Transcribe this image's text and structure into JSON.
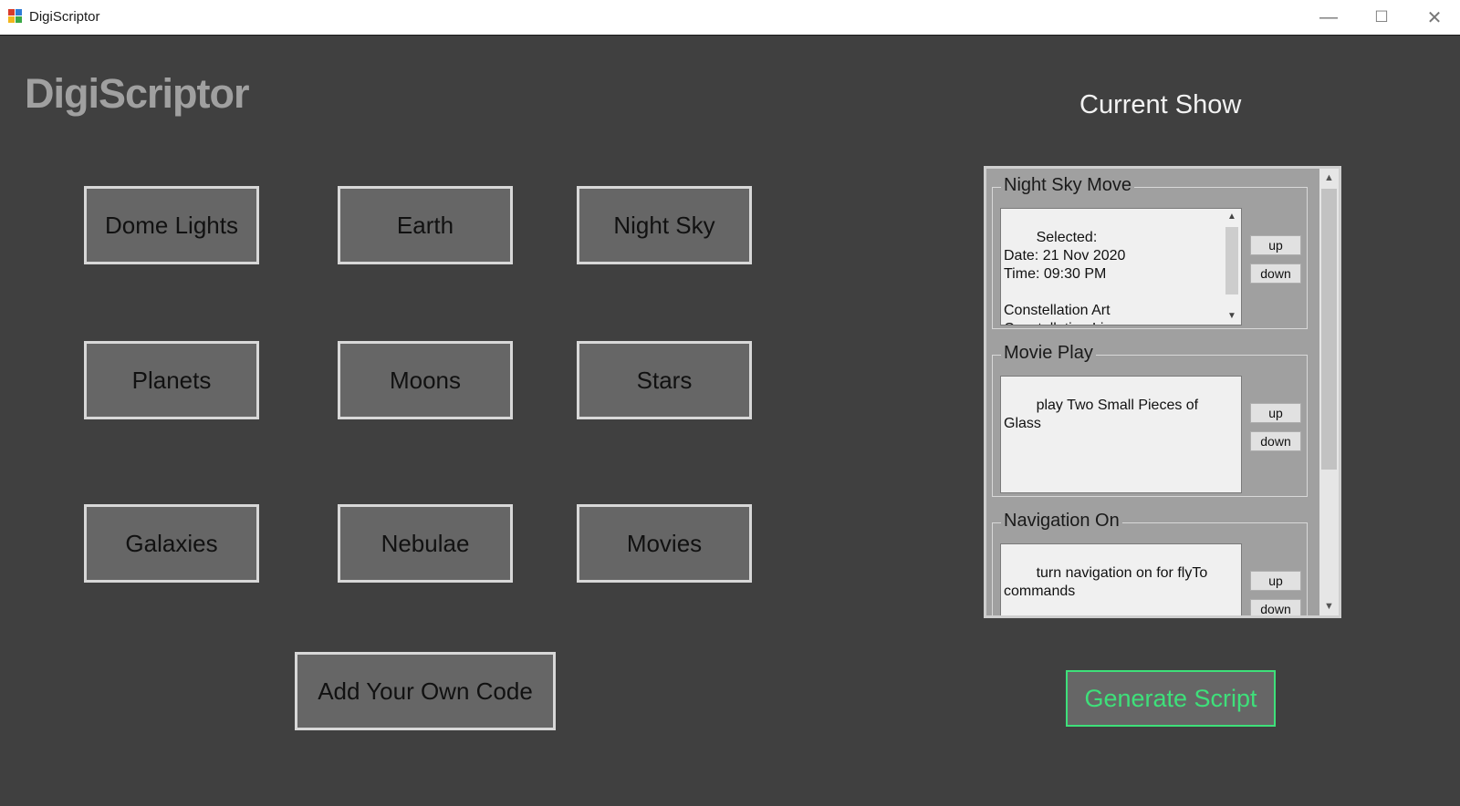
{
  "window": {
    "title": "DigiScriptor",
    "minimize": "—",
    "maximize": "☐",
    "close": "✕"
  },
  "app": {
    "logo": "DigiScriptor",
    "current_show_title": "Current Show",
    "generate_label": "Generate Script"
  },
  "categories": [
    {
      "label": "Dome Lights"
    },
    {
      "label": "Earth"
    },
    {
      "label": "Night Sky"
    },
    {
      "label": "Planets"
    },
    {
      "label": "Moons"
    },
    {
      "label": "Stars"
    },
    {
      "label": "Galaxies"
    },
    {
      "label": "Nebulae"
    },
    {
      "label": "Movies"
    },
    {
      "label": "Add Your Own Code"
    }
  ],
  "show_items": [
    {
      "title": "Night Sky Move",
      "text": "Selected:\nDate: 21 Nov 2020\nTime: 09:30 PM\n\nConstellation Art\nConstellation Lines",
      "up": "up",
      "down": "down"
    },
    {
      "title": "Movie Play",
      "text": "play Two Small Pieces of Glass",
      "up": "up",
      "down": "down"
    },
    {
      "title": "Navigation On",
      "text": "turn navigation on for flyTo commands",
      "up": "up",
      "down": "down"
    }
  ],
  "colors": {
    "background": "#404040",
    "button_face": "#666666",
    "panel": "#a0a0a0",
    "accent": "#3ee07a"
  },
  "icons": {
    "app_icon": "app-grid-icon",
    "scroll_up": "chevron-up-icon",
    "scroll_down": "chevron-down-icon"
  }
}
